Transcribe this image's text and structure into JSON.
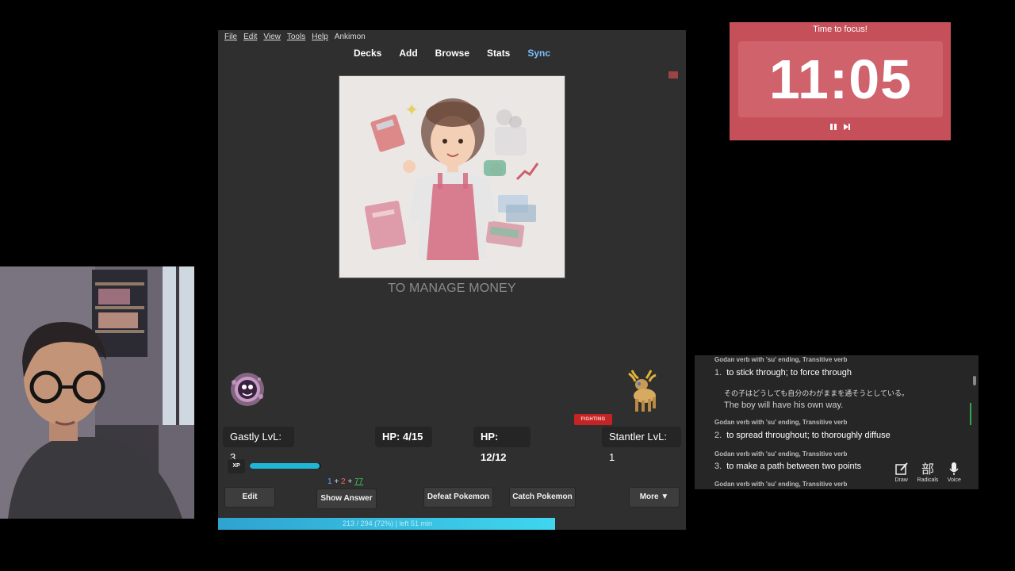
{
  "anki": {
    "menu": [
      "File",
      "Edit",
      "View",
      "Tools",
      "Help",
      "Ankimon"
    ],
    "toplinks": [
      "Decks",
      "Add",
      "Browse",
      "Stats",
      "Sync"
    ],
    "card_text": "TO MANAGE MONEY",
    "battle": {
      "player_name": "Gastly LvL: 3",
      "player_hp": "HP: 4/15",
      "enemy_hp": "HP: 12/12",
      "enemy_name": "Stantler LvL: 1",
      "enemy_type_badge": "FIGHTING",
      "xp_label": "XP",
      "xp_fraction": 0.98
    },
    "counts": {
      "new": "1",
      "plus1": "+",
      "learning": "2",
      "plus2": "+",
      "review": "77"
    },
    "buttons": {
      "edit": "Edit",
      "show_answer": "Show Answer",
      "defeat": "Defeat Pokemon",
      "catch": "Catch Pokemon",
      "more": "More ▼"
    },
    "progress": {
      "text": "213 / 294 (72%) | left 51 min",
      "fraction": 0.72
    }
  },
  "timer": {
    "title": "Time to focus!",
    "time": "11:05",
    "pause_icon": "pause-icon",
    "skip_icon": "skip-icon"
  },
  "dictionary": {
    "entries": [
      {
        "pos": "Godan verb with 'su' ending, Transitive verb",
        "num": "1.",
        "def": "to stick through; to force through",
        "jp": "その子はどうしても自分のわがままを通そうとしている。",
        "en": "The boy will have his own way."
      },
      {
        "pos": "Godan verb with 'su' ending, Transitive verb",
        "num": "2.",
        "def": "to spread throughout; to thoroughly diffuse"
      },
      {
        "pos": "Godan verb with 'su' ending, Transitive verb",
        "num": "3.",
        "def": "to make a path between two points"
      },
      {
        "pos": "Godan verb with 'su' ending, Transitive verb"
      }
    ],
    "tools": [
      {
        "icon": "draw-icon",
        "label": "Draw"
      },
      {
        "icon": "radicals-icon",
        "label": "Radicals"
      },
      {
        "icon": "microphone-icon",
        "label": "Voice"
      }
    ]
  },
  "colors": {
    "timer_bg": "#c6505a",
    "progress": "#3fd6ee",
    "xp": "#1fb6d6",
    "badge": "#c42424",
    "sync_link": "#7cc0ff"
  }
}
